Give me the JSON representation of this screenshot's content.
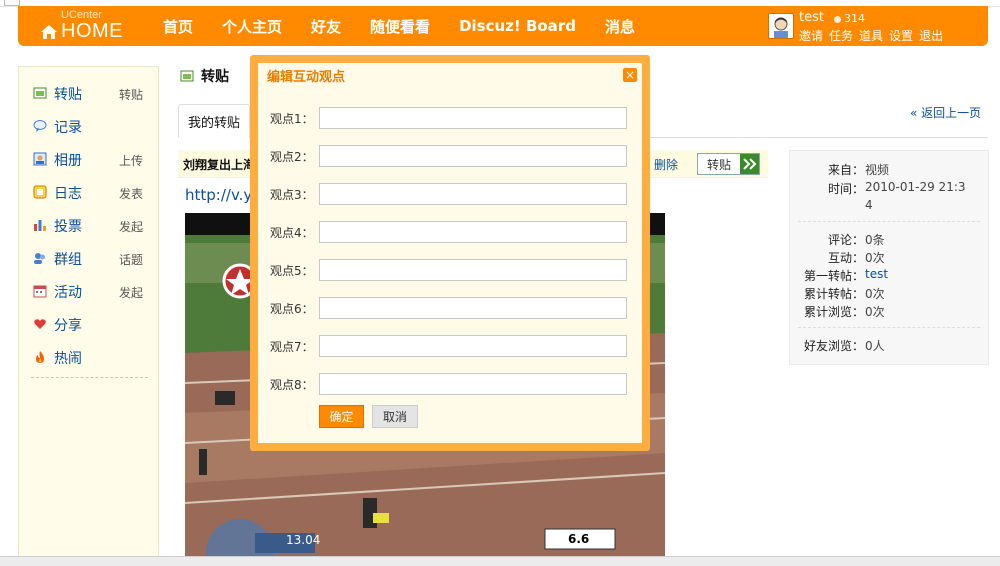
{
  "header": {
    "logo_small": "UCenter",
    "logo_big": "HOME",
    "nav": [
      "首页",
      "个人主页",
      "好友",
      "随便看看",
      "Discuz! Board",
      "消息"
    ],
    "user": {
      "name": "test",
      "credits": "314",
      "links": [
        "邀请",
        "任务",
        "道具",
        "设置",
        "退出"
      ]
    }
  },
  "sidebar": {
    "items": [
      {
        "label": "转贴",
        "sub": "转贴",
        "icon": "share-post-icon"
      },
      {
        "label": "记录",
        "sub": "",
        "icon": "speech-bubble-icon"
      },
      {
        "label": "相册",
        "sub": "上传",
        "icon": "photo-album-icon"
      },
      {
        "label": "日志",
        "sub": "发表",
        "icon": "blog-icon"
      },
      {
        "label": "投票",
        "sub": "发起",
        "icon": "poll-icon"
      },
      {
        "label": "群组",
        "sub": "话题",
        "icon": "group-icon"
      },
      {
        "label": "活动",
        "sub": "发起",
        "icon": "calendar-icon"
      },
      {
        "label": "分享",
        "sub": "",
        "icon": "heart-icon"
      },
      {
        "label": "热闹",
        "sub": "",
        "icon": "fire-icon"
      }
    ]
  },
  "main": {
    "page_title": "转贴",
    "tab": "我的转贴",
    "back_link": "« 返回上一页",
    "post_title": "刘翔复出上海",
    "delete_label": "删除",
    "repost_button": "转贴",
    "link_text": "http://v.y"
  },
  "info": {
    "source_label": "来自：",
    "source_value": "视频",
    "time_label": "时间：",
    "time_value_1": "2010-01-29 21:3",
    "time_value_2": "4",
    "comments_label": "评论：",
    "comments_value": "0条",
    "interact_label": "互动：",
    "interact_value": "0次",
    "first_label": "第一转帖：",
    "first_value": "test",
    "total_repost_label": "累计转帖：",
    "total_repost_value": "0次",
    "total_view_label": "累计浏览：",
    "total_view_value": "0次",
    "friend_view_label": "好友浏览：",
    "friend_view_value": "0人"
  },
  "modal": {
    "title": "编辑互动观点",
    "fields": [
      {
        "label": "观点1：",
        "value": ""
      },
      {
        "label": "观点2：",
        "value": ""
      },
      {
        "label": "观点3：",
        "value": ""
      },
      {
        "label": "观点4：",
        "value": ""
      },
      {
        "label": "观点5：",
        "value": ""
      },
      {
        "label": "观点6：",
        "value": ""
      },
      {
        "label": "观点7：",
        "value": ""
      },
      {
        "label": "观点8：",
        "value": ""
      }
    ],
    "ok_label": "确定",
    "cancel_label": "取消"
  },
  "video": {
    "overlay_left": "13.04",
    "overlay_right": "6.6"
  },
  "colors": {
    "header": "#ff8a00",
    "modal_border": "#ffad3e",
    "link": "#0a4fa0"
  }
}
